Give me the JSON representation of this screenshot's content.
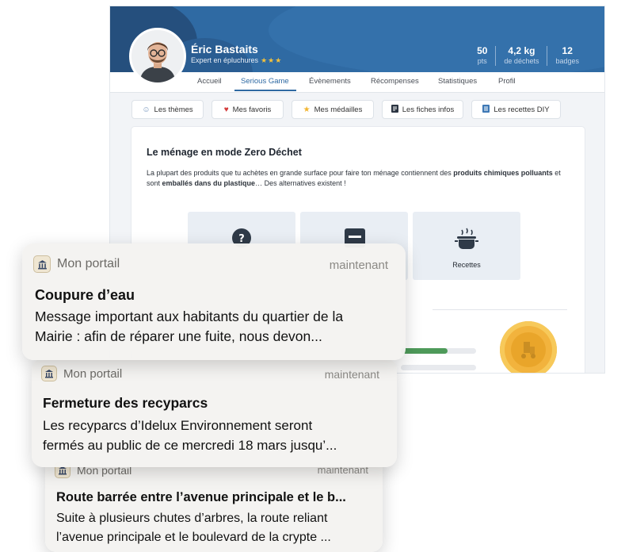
{
  "profile": {
    "name": "Éric Bastaits",
    "subtitle": "Expert en épluchures",
    "stars": "★★★",
    "stats": [
      {
        "value": "50",
        "label": "pts"
      },
      {
        "value": "4,2 kg",
        "label": "de déchets"
      },
      {
        "value": "12",
        "label": "badges"
      }
    ]
  },
  "nav": {
    "items": [
      "Accueil",
      "Serious Game",
      "Évènements",
      "Récompenses",
      "Statistiques",
      "Profil"
    ],
    "active": "Serious Game"
  },
  "chips": [
    {
      "label": "Les thèmes",
      "icon": "smile-icon"
    },
    {
      "label": "Mes favoris",
      "icon": "heart-icon"
    },
    {
      "label": "Mes médailles",
      "icon": "star-icon"
    },
    {
      "label": "Les fiches infos",
      "icon": "document-icon"
    },
    {
      "label": "Les recettes DIY",
      "icon": "list-icon"
    }
  ],
  "card": {
    "title": "Le ménage en mode Zero Déchet",
    "text_1": "La plupart des produits que tu achètes en grande surface pour faire ton ménage contiennent des ",
    "text_bold_1": "produits chimiques polluants",
    "text_2": " et sont ",
    "text_bold_2": "emballés dans du plastique",
    "text_3": "… Des alternatives existent !",
    "tiles": [
      {
        "label": "",
        "icon": "quiz-icon"
      },
      {
        "label": "",
        "icon": "info-card-icon"
      },
      {
        "label": "Recettes",
        "icon": "cooking-pot-icon"
      }
    ],
    "progress": [
      0.62,
      0
    ]
  },
  "notifications": [
    {
      "app": "Mon portail",
      "time": "maintenant",
      "title": "Coupure d’eau",
      "body_line1": "Message important aux habitants du quartier de la",
      "body_line2": "Mairie : afin de réparer une fuite, nous devon..."
    },
    {
      "app": "Mon portail",
      "time": "maintenant",
      "title": "Fermeture des recyparcs",
      "body_line1": "Les recyparcs d’Idelux Environnement seront",
      "body_line2": "fermés au public de ce mercredi 18 mars jusqu’..."
    },
    {
      "app": "Mon portail",
      "time": "maintenant",
      "title": "Route barrée entre l’avenue principale et le b...",
      "body_line1": "Suite à plusieurs chutes d’arbres, la route reliant",
      "body_line2": "l’avenue principale et le boulevard de la crypte ..."
    }
  ]
}
